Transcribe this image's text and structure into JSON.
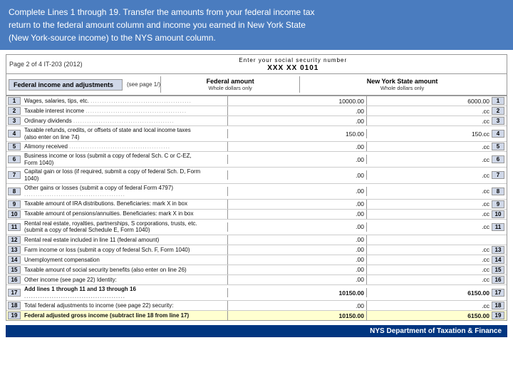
{
  "header": {
    "line1": "Complete Lines 1 through 19.  Transfer the amounts from your federal income tax",
    "line2": "return to the federal amount column and income you earned in New York State",
    "line3": "(New York-source income) to the NYS amount column."
  },
  "form": {
    "page_id": "Page 2 of 4   IT-203 (2012)",
    "ssn_label": "Enter your social security number",
    "ssn_value": "XXX XX 0101",
    "section_title": "Federal income and adjustments",
    "see_page": "(see page 1/)",
    "col_federal_title": "Federal amount",
    "col_federal_sub": "Whole dollars only",
    "col_nys_title": "New York State amount",
    "col_nys_sub": "Whole dollars only",
    "rows": [
      {
        "line": "1",
        "desc": "Wages, salaries, tips, etc. ",
        "dots": true,
        "federal_val": "10000.00",
        "nys_line": "1",
        "nys_val": "6000.00"
      },
      {
        "line": "2",
        "desc": "Taxable interest income ",
        "dots": true,
        "federal_val": ".00",
        "nys_line": "2",
        "nys_val": ".cc"
      },
      {
        "line": "3",
        "desc": "Ordinary dividends ",
        "dots": true,
        "federal_val": ".00",
        "nys_line": "3",
        "nys_val": ".cc"
      },
      {
        "line": "4",
        "desc": "Taxable refunds, credits, or offsets of state and local income taxes (also enter on line 74)",
        "dots": false,
        "federal_val": "150.00",
        "nys_line": "4",
        "nys_val": "150.cc"
      },
      {
        "line": "5",
        "desc": "Alimony received ",
        "dots": true,
        "federal_val": ".00",
        "nys_line": "5",
        "nys_val": ".cc"
      },
      {
        "line": "6",
        "desc": "Business income or loss (submit a copy of federal Sch. C or C-EZ, Form 1040)",
        "dots": false,
        "federal_val": ".00",
        "nys_line": "6",
        "nys_val": ".cc"
      },
      {
        "line": "7",
        "desc": "Capital gain or loss (if required, submit a copy of federal Sch. D, Form 1040)",
        "dots": false,
        "federal_val": ".00",
        "nys_line": "7",
        "nys_val": ".cc"
      },
      {
        "line": "8",
        "desc": "Other gains or losses (submit a copy of federal Form 4797) ",
        "dots": true,
        "federal_val": ".00",
        "nys_line": "8",
        "nys_val": ".cc"
      },
      {
        "line": "9",
        "desc": "Taxable amount of IRA distributions. Beneficiaries: mark X in box",
        "dots": false,
        "federal_val": ".00",
        "nys_line": "9",
        "nys_val": ".cc"
      },
      {
        "line": "10",
        "desc": "Taxable amount of pensions/annuities. Beneficiaries: mark X in box",
        "dots": false,
        "federal_val": ".00",
        "nys_line": "10",
        "nys_val": ".cc"
      },
      {
        "line": "11",
        "desc": "Rental real estate, royalties, partnerships, S corporations, trusts, etc. (submit a copy of federal Schedule E, Form 1040)",
        "dots": false,
        "federal_val": ".00",
        "nys_line": "11",
        "nys_val": ".cc"
      },
      {
        "line": "12",
        "desc": "Rental real estate included in line 11 (federal amount)",
        "dots": false,
        "federal_val": ".00",
        "nys_line": "",
        "nys_val": ""
      },
      {
        "line": "13",
        "desc": "Farm income or loss (submit a copy of federal Sch. F, Form 1040)",
        "dots": false,
        "federal_val": ".00",
        "nys_line": "13",
        "nys_val": ".cc"
      },
      {
        "line": "14",
        "desc": "Unemployment compensation",
        "dots": false,
        "federal_val": ".00",
        "nys_line": "14",
        "nys_val": ".cc"
      },
      {
        "line": "15",
        "desc": "Taxable amount of social security benefits (also enter on line 26)",
        "dots": false,
        "federal_val": ".00",
        "nys_line": "15",
        "nys_val": ".cc"
      },
      {
        "line": "16",
        "desc": "Other income (see page 22) Identity:",
        "dots": false,
        "federal_val": ".00",
        "nys_line": "16",
        "nys_val": ".cc"
      },
      {
        "line": "17",
        "desc": "Add lines 1 through 11 and 13 through 16 ",
        "dots": true,
        "federal_val": "10150.00",
        "nys_line": "17",
        "nys_val": "6150.00",
        "bold": true
      },
      {
        "line": "18",
        "desc": "Total federal adjustments to income (see page 22) security:",
        "dots": false,
        "federal_val": ".00",
        "nys_line": "18",
        "nys_val": ".cc"
      },
      {
        "line": "19",
        "desc": "Federal adjusted gross income (subtract line 18 from line 17)",
        "dots": false,
        "federal_val": "10150.00",
        "nys_line": "19",
        "nys_val": "6150.00",
        "bold": true,
        "highlighted": true
      }
    ]
  },
  "footer": {
    "text": "NYS Department of Taxation & Finance"
  }
}
